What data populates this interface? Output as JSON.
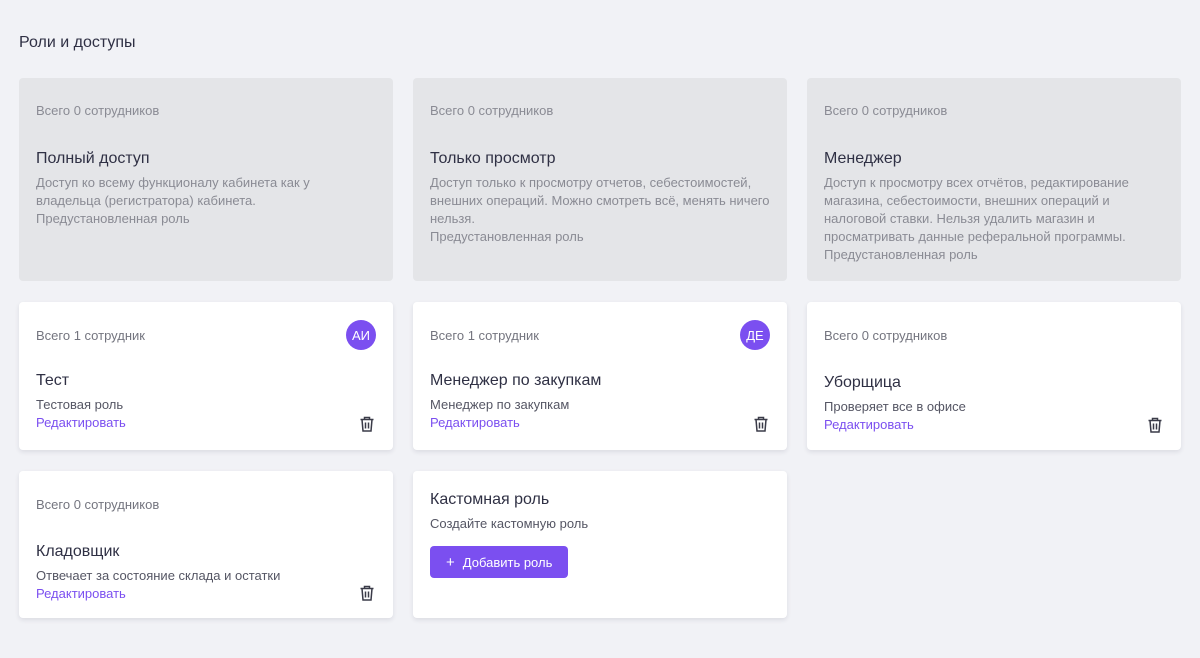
{
  "page": {
    "title": "Роли и доступы"
  },
  "preset_roles": [
    {
      "count": "Всего 0 сотрудников",
      "title": "Полный доступ",
      "desc": "Доступ ко всему функционалу кабинета как у владельца (регистратора) кабинета.",
      "note": "Предустановленная роль"
    },
    {
      "count": "Всего 0 сотрудников",
      "title": "Только просмотр",
      "desc": "Доступ только к просмотру отчетов, себестоимостей, внешних операций. Можно смотреть всё, менять ничего нельзя.",
      "note": "Предустановленная роль"
    },
    {
      "count": "Всего 0 сотрудников",
      "title": "Менеджер",
      "desc": "Доступ к просмотру всех отчётов, редактирование магазина, себестоимости, внешних операций и налоговой ставки. Нельзя удалить магазин и просматривать данные реферальной программы.",
      "note": "Предустановленная роль"
    }
  ],
  "custom_roles": [
    {
      "count": "Всего 1 сотрудник",
      "avatar": "АИ",
      "title": "Тест",
      "desc": "Тестовая роль",
      "edit": "Редактировать"
    },
    {
      "count": "Всего 1 сотрудник",
      "avatar": "ДЕ",
      "title": "Менеджер по закупкам",
      "desc": "Менеджер по закупкам",
      "edit": "Редактировать"
    },
    {
      "count": "Всего 0 сотрудников",
      "title": "Уборщица",
      "desc": "Проверяет все в офисе",
      "edit": "Редактировать"
    },
    {
      "count": "Всего 0 сотрудников",
      "title": "Кладовщик",
      "desc": "Отвечает за состояние склада и остатки",
      "edit": "Редактировать"
    }
  ],
  "add_card": {
    "title": "Кастомная роль",
    "desc": "Создайте кастомную роль",
    "button": "Добавить роль",
    "button_icon": "+"
  },
  "colors": {
    "accent": "#7b4ff0",
    "background": "#f1f2f6",
    "preset_card": "#e4e5e8"
  },
  "icons": {
    "delete": "trash-icon",
    "add": "plus-icon"
  }
}
